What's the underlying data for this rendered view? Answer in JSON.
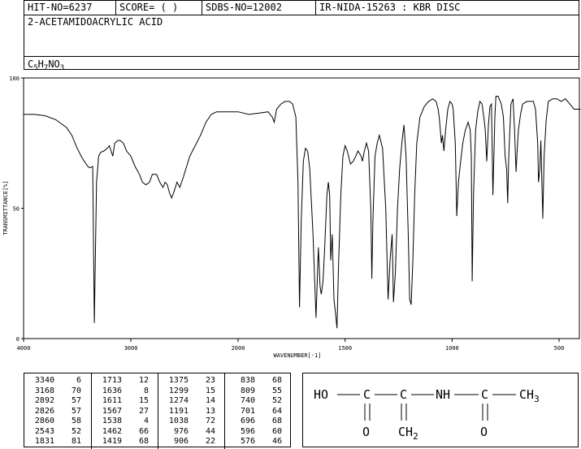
{
  "header": {
    "hit_no": "HIT-NO=6237",
    "score": "SCORE=  (   )",
    "sdbs_no": "SDBS-NO=12002",
    "ir_info": "IR-NIDA-15263 : KBR DISC",
    "compound_name": "2-ACETAMIDOACRYLIC ACID",
    "formula": {
      "c": "C",
      "c_n": "5",
      "h": "H",
      "h_n": "7",
      "rest": "NO",
      "o_n": "3"
    }
  },
  "chart_data": {
    "type": "line",
    "title": "",
    "xlabel": "WAVENUMBER[-1]",
    "ylabel": "TRANSMITTANCE[%]",
    "xlim": [
      4000,
      400
    ],
    "ylim": [
      0,
      100
    ],
    "x_ticks": [
      "4000",
      "3000",
      "2000",
      "1500",
      "1000",
      "500"
    ],
    "y_ticks": [
      "100",
      "50",
      "0"
    ],
    "grid": false,
    "series": [
      {
        "color": "#000000",
        "points": [
          [
            4000,
            86
          ],
          [
            3900,
            86
          ],
          [
            3800,
            85.5
          ],
          [
            3700,
            84
          ],
          [
            3600,
            81
          ],
          [
            3550,
            78
          ],
          [
            3500,
            73
          ],
          [
            3450,
            69
          ],
          [
            3400,
            66
          ],
          [
            3380,
            65.5
          ],
          [
            3355,
            66
          ],
          [
            3340,
            6
          ],
          [
            3320,
            60
          ],
          [
            3300,
            70
          ],
          [
            3280,
            71.5
          ],
          [
            3250,
            72
          ],
          [
            3220,
            73
          ],
          [
            3200,
            74
          ],
          [
            3168,
            70
          ],
          [
            3150,
            75
          ],
          [
            3120,
            76
          ],
          [
            3100,
            76
          ],
          [
            3070,
            75
          ],
          [
            3040,
            72
          ],
          [
            3000,
            70
          ],
          [
            2960,
            66
          ],
          [
            2920,
            63
          ],
          [
            2892,
            60
          ],
          [
            2860,
            59
          ],
          [
            2826,
            60
          ],
          [
            2800,
            63
          ],
          [
            2760,
            63
          ],
          [
            2730,
            60
          ],
          [
            2700,
            58
          ],
          [
            2680,
            60
          ],
          [
            2660,
            59
          ],
          [
            2640,
            56
          ],
          [
            2620,
            54
          ],
          [
            2600,
            56
          ],
          [
            2570,
            60
          ],
          [
            2543,
            58
          ],
          [
            2510,
            62
          ],
          [
            2480,
            66
          ],
          [
            2450,
            70
          ],
          [
            2400,
            74
          ],
          [
            2350,
            78
          ],
          [
            2300,
            83
          ],
          [
            2250,
            86
          ],
          [
            2200,
            87
          ],
          [
            2100,
            87
          ],
          [
            2000,
            87
          ],
          [
            1950,
            86
          ],
          [
            1900,
            86.5
          ],
          [
            1860,
            87
          ],
          [
            1840,
            85
          ],
          [
            1831,
            83
          ],
          [
            1820,
            88
          ],
          [
            1800,
            90
          ],
          [
            1780,
            91
          ],
          [
            1760,
            91
          ],
          [
            1745,
            90
          ],
          [
            1730,
            85
          ],
          [
            1720,
            60
          ],
          [
            1713,
            12
          ],
          [
            1705,
            45
          ],
          [
            1695,
            68
          ],
          [
            1685,
            73
          ],
          [
            1675,
            72
          ],
          [
            1665,
            65
          ],
          [
            1650,
            40
          ],
          [
            1636,
            8
          ],
          [
            1625,
            35
          ],
          [
            1617,
            20
          ],
          [
            1611,
            17
          ],
          [
            1603,
            22
          ],
          [
            1595,
            35
          ],
          [
            1585,
            55
          ],
          [
            1578,
            60
          ],
          [
            1572,
            55
          ],
          [
            1567,
            30
          ],
          [
            1560,
            40
          ],
          [
            1552,
            15
          ],
          [
            1545,
            10
          ],
          [
            1538,
            4
          ],
          [
            1530,
            30
          ],
          [
            1520,
            55
          ],
          [
            1510,
            70
          ],
          [
            1500,
            74
          ],
          [
            1490,
            72
          ],
          [
            1475,
            67
          ],
          [
            1462,
            68
          ],
          [
            1450,
            70
          ],
          [
            1440,
            72
          ],
          [
            1425,
            70
          ],
          [
            1419,
            68
          ],
          [
            1410,
            72
          ],
          [
            1400,
            75
          ],
          [
            1390,
            72
          ],
          [
            1380,
            50
          ],
          [
            1375,
            23
          ],
          [
            1370,
            45
          ],
          [
            1360,
            70
          ],
          [
            1350,
            75
          ],
          [
            1340,
            78
          ],
          [
            1325,
            73
          ],
          [
            1310,
            50
          ],
          [
            1299,
            15
          ],
          [
            1290,
            30
          ],
          [
            1280,
            40
          ],
          [
            1274,
            14
          ],
          [
            1265,
            25
          ],
          [
            1255,
            50
          ],
          [
            1245,
            65
          ],
          [
            1235,
            75
          ],
          [
            1225,
            82
          ],
          [
            1215,
            70
          ],
          [
            1205,
            40
          ],
          [
            1198,
            15
          ],
          [
            1191,
            13
          ],
          [
            1183,
            30
          ],
          [
            1175,
            55
          ],
          [
            1165,
            75
          ],
          [
            1150,
            85
          ],
          [
            1130,
            89
          ],
          [
            1110,
            91
          ],
          [
            1090,
            92
          ],
          [
            1075,
            91
          ],
          [
            1065,
            88
          ],
          [
            1060,
            85
          ],
          [
            1055,
            80
          ],
          [
            1050,
            75
          ],
          [
            1045,
            78
          ],
          [
            1038,
            72
          ],
          [
            1030,
            80
          ],
          [
            1020,
            88
          ],
          [
            1010,
            91
          ],
          [
            1000,
            90
          ],
          [
            995,
            88
          ],
          [
            985,
            75
          ],
          [
            978,
            47
          ],
          [
            970,
            60
          ],
          [
            960,
            68
          ],
          [
            950,
            75
          ],
          [
            938,
            80
          ],
          [
            925,
            83
          ],
          [
            915,
            80
          ],
          [
            910,
            70
          ],
          [
            906,
            22
          ],
          [
            900,
            55
          ],
          [
            890,
            80
          ],
          [
            880,
            87
          ],
          [
            870,
            91
          ],
          [
            860,
            90
          ],
          [
            850,
            84
          ],
          [
            845,
            80
          ],
          [
            838,
            68
          ],
          [
            830,
            82
          ],
          [
            823,
            89
          ],
          [
            816,
            90
          ],
          [
            809,
            55
          ],
          [
            800,
            85
          ],
          [
            795,
            93
          ],
          [
            785,
            93
          ],
          [
            770,
            90
          ],
          [
            760,
            85
          ],
          [
            752,
            70
          ],
          [
            745,
            65
          ],
          [
            740,
            52
          ],
          [
            735,
            70
          ],
          [
            725,
            90
          ],
          [
            715,
            92
          ],
          [
            708,
            80
          ],
          [
            701,
            64
          ],
          [
            696,
            72
          ],
          [
            690,
            80
          ],
          [
            680,
            86
          ],
          [
            670,
            90
          ],
          [
            650,
            91
          ],
          [
            620,
            91
          ],
          [
            610,
            88
          ],
          [
            600,
            75
          ],
          [
            596,
            60
          ],
          [
            590,
            65
          ],
          [
            585,
            76
          ],
          [
            576,
            46
          ],
          [
            570,
            70
          ],
          [
            560,
            84
          ],
          [
            550,
            91
          ],
          [
            530,
            92
          ],
          [
            510,
            92
          ],
          [
            490,
            91
          ],
          [
            470,
            92
          ],
          [
            450,
            90
          ],
          [
            430,
            88
          ],
          [
            410,
            88
          ],
          [
            400,
            88
          ]
        ]
      }
    ]
  },
  "peak_table": {
    "columns": [
      [
        [
          "3340",
          "6"
        ],
        [
          "3168",
          "70"
        ],
        [
          "2892",
          "57"
        ],
        [
          "2826",
          "57"
        ],
        [
          "2860",
          "58"
        ],
        [
          "2543",
          "52"
        ],
        [
          "1831",
          "81"
        ]
      ],
      [
        [
          "1713",
          "12"
        ],
        [
          "1636",
          "8"
        ],
        [
          "1611",
          "15"
        ],
        [
          "1567",
          "27"
        ],
        [
          "1538",
          "4"
        ],
        [
          "1462",
          "66"
        ],
        [
          "1419",
          "68"
        ]
      ],
      [
        [
          "1375",
          "23"
        ],
        [
          "1299",
          "15"
        ],
        [
          "1274",
          "14"
        ],
        [
          "1191",
          "13"
        ],
        [
          "1038",
          "72"
        ],
        [
          "976",
          "44"
        ],
        [
          "906",
          "22"
        ]
      ],
      [
        [
          "838",
          "68"
        ],
        [
          "809",
          "55"
        ],
        [
          "740",
          "52"
        ],
        [
          "701",
          "64"
        ],
        [
          "696",
          "68"
        ],
        [
          "596",
          "60"
        ],
        [
          "576",
          "46"
        ]
      ]
    ]
  },
  "structure": {
    "ho": "HO",
    "c1": "C",
    "c2": "C",
    "nh": "NH",
    "c3": "C",
    "ch3": "CH",
    "ch3_n": "3",
    "o1": "O",
    "o2": "O",
    "ch2": "CH",
    "ch2_n": "2"
  }
}
